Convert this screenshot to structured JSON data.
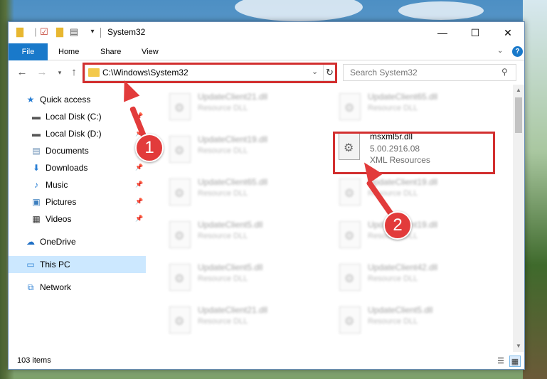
{
  "window": {
    "title": "System32"
  },
  "titlebar": {
    "minimize": "—",
    "maximize": "☐",
    "close": "✕"
  },
  "ribbon": {
    "tabs": [
      "File",
      "Home",
      "Share",
      "View"
    ]
  },
  "nav": {
    "address": "C:\\Windows\\System32",
    "search_placeholder": "Search System32"
  },
  "sidebar": {
    "items": [
      {
        "label": "Quick access",
        "icon": "star-icon",
        "color": "#2a7fd4"
      },
      {
        "label": "Local Disk (C:)",
        "icon": "drive-icon",
        "pinned": true
      },
      {
        "label": "Local Disk (D:)",
        "icon": "drive-icon",
        "pinned": true
      },
      {
        "label": "Documents",
        "icon": "documents-icon",
        "pinned": true
      },
      {
        "label": "Downloads",
        "icon": "downloads-icon",
        "pinned": true
      },
      {
        "label": "Music",
        "icon": "music-icon",
        "pinned": true
      },
      {
        "label": "Pictures",
        "icon": "pictures-icon",
        "pinned": true
      },
      {
        "label": "Videos",
        "icon": "videos-icon",
        "pinned": true
      },
      {
        "label": "OneDrive",
        "icon": "onedrive-icon"
      },
      {
        "label": "This PC",
        "icon": "computer-icon",
        "selected": true
      },
      {
        "label": "Network",
        "icon": "network-icon"
      }
    ]
  },
  "files": [
    {
      "name": "UpdateClient21.dll",
      "type": "Resource DLL"
    },
    {
      "name": "UpdateClient65.dll",
      "type": "Resource DLL"
    },
    {
      "name": "UpdateClient19.dll",
      "type": "Resource DLL"
    },
    {
      "name": "UpdateClient65.dll",
      "type": "Resource DLL"
    },
    {
      "name": "UpdateClient19.dll",
      "type": "Resource DLL"
    },
    {
      "name": "UpdateClient5.dll",
      "type": "Resource DLL"
    },
    {
      "name": "UpdateClient19.dll",
      "type": "Resource DLL"
    },
    {
      "name": "UpdateClient5.dll",
      "type": "Resource DLL"
    },
    {
      "name": "UpdateClient42.dll",
      "type": "Resource DLL"
    },
    {
      "name": "UpdateClient21.dll",
      "type": "Resource DLL"
    },
    {
      "name": "UpdateClient5.dll",
      "type": "Resource DLL"
    }
  ],
  "focused_file": {
    "name": "msxml5r.dll",
    "version": "5.00.2916.08",
    "type": "XML Resources"
  },
  "status": {
    "item_count": "103 items"
  },
  "annotations": {
    "step1": "1",
    "step2": "2",
    "color": "#e23b3b"
  }
}
